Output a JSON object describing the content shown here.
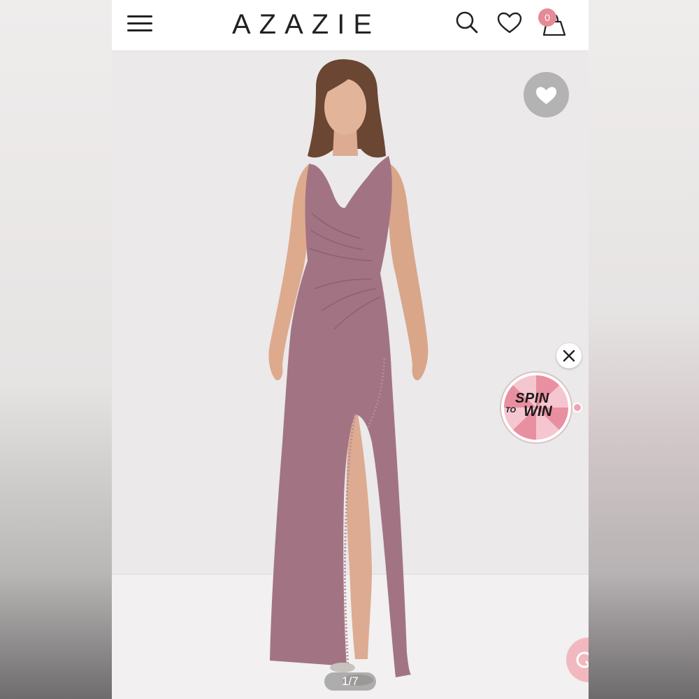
{
  "header": {
    "logo_text": "AZAZIE",
    "cart_count": "0",
    "icons": [
      "menu-icon",
      "search-icon",
      "heart-icon",
      "shopping-bag-icon"
    ]
  },
  "gallery": {
    "counter": "1/7",
    "dress_color": "#a27483"
  },
  "promo": {
    "spin_line1": "SPIN",
    "spin_line2": "TO",
    "spin_line3": "WIN"
  },
  "colors": {
    "brand_pink": "#e58a97",
    "dress": "#a27483"
  }
}
